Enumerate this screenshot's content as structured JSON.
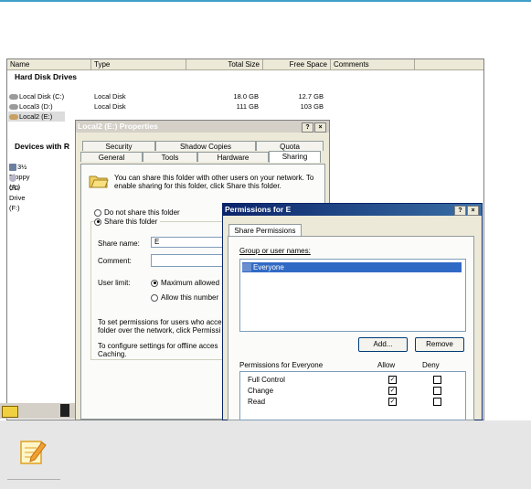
{
  "explorer": {
    "columns": [
      "Name",
      "Type",
      "Total Size",
      "Free Space",
      "Comments"
    ],
    "groups": {
      "hard_disk": "Hard Disk Drives",
      "devices": "Devices with R"
    },
    "drives": [
      {
        "name": "Local Disk (C:)",
        "type": "Local Disk",
        "total": "18.0 GB",
        "free": "12.7 GB"
      },
      {
        "name": "Local3 (D:)",
        "type": "Local Disk",
        "total": "111 GB",
        "free": "103 GB"
      },
      {
        "name": "Local2 (E:)",
        "type": "",
        "total": "",
        "free": ""
      }
    ],
    "devices": [
      {
        "name": "3½ Floppy (A:)"
      },
      {
        "name": "CD Drive (F:)"
      }
    ]
  },
  "properties": {
    "title": "Local2 (E:) Properties",
    "help_btn": "?",
    "close_btn": "×",
    "tabs_top": [
      "Security",
      "Shadow Copies",
      "Quota"
    ],
    "tabs_bottom": [
      "General",
      "Tools",
      "Hardware",
      "Sharing"
    ],
    "share_intro": "You can share this folder with other users on your network. To enable sharing for this folder, click Share this folder.",
    "do_not_share": "Do not share this folder",
    "share_this": "Share this folder",
    "share_name_label": "Share name:",
    "share_name_value": "E",
    "comment_label": "Comment:",
    "comment_value": "",
    "user_limit_label": "User limit:",
    "max_allowed": "Maximum allowed",
    "allow_this_number": "Allow this number",
    "perm_text": "To set permissions for users who acce folder over the network, click Permissi",
    "offline_text": "To configure settings for offline acces Caching."
  },
  "permissions": {
    "title": "Permissions for E",
    "help_btn": "?",
    "close_btn": "×",
    "tab": "Share Permissions",
    "group_label": "Group or user names:",
    "users": [
      "Everyone"
    ],
    "add_btn": "Add...",
    "remove_btn": "Remove",
    "perm_label": "Permissions for Everyone",
    "allow_header": "Allow",
    "deny_header": "Deny",
    "rows": [
      {
        "name": "Full Control",
        "allow": true,
        "deny": false
      },
      {
        "name": "Change",
        "allow": true,
        "deny": false
      },
      {
        "name": "Read",
        "allow": true,
        "deny": false
      }
    ]
  },
  "colors": {
    "accent": "#3fa0c8",
    "title_active": "#0a246a",
    "note_bg": "#e6e6e6"
  },
  "note": {
    "icon": "note-pencil-icon"
  }
}
